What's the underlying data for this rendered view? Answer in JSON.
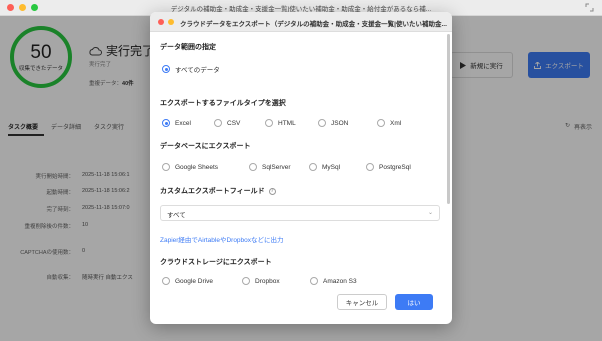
{
  "window": {
    "title": "デジタルの補助金・助成金・支援金一覧|使いたい補助金・助成金・給付金があるなら補..."
  },
  "summary": {
    "count": "50",
    "count_caption": "収集できたデータ",
    "status_title": "実行完了",
    "status_sub": "実行完了",
    "dedupe_label": "重複データ：",
    "dedupe_value": "40件"
  },
  "toolbar": {
    "run_label": "新規に実行",
    "export_label": "エクスポート"
  },
  "tabs": [
    {
      "label": "タスク概要"
    },
    {
      "label": "データ詳細"
    },
    {
      "label": "タスク実行"
    }
  ],
  "refresh_label": "再表示",
  "details": [
    {
      "label": "実行開始時間：",
      "value": "2025-11-18 15:06:1"
    },
    {
      "label": "起動時間：",
      "value": "2025-11-18 15:06:2"
    },
    {
      "label": "完了時刻：",
      "value": "2025-11-18 15:07:0"
    },
    {
      "label": "重複削除後の件数：",
      "value": "10"
    },
    {
      "label": "CAPTCHAの使用数：",
      "value": "0"
    },
    {
      "label": "自動収集：",
      "value": "随時実行 自動エクス"
    }
  ],
  "modal": {
    "title": "クラウドデータをエクスポート（デジタルの補助金・助成金・支援金一覧|使いたい補助金...",
    "range_title": "データ範囲の指定",
    "range_option": "すべてのデータ",
    "filetype_title": "エクスポートするファイルタイプを選択",
    "filetypes": [
      {
        "label": "Excel",
        "checked": true
      },
      {
        "label": "CSV",
        "checked": false
      },
      {
        "label": "HTML",
        "checked": false
      },
      {
        "label": "JSON",
        "checked": false
      },
      {
        "label": "Xml",
        "checked": false
      }
    ],
    "db_title": "データベースにエクスポート",
    "databases": [
      {
        "label": "Google Sheets"
      },
      {
        "label": "SqlServer"
      },
      {
        "label": "MySql"
      },
      {
        "label": "PostgreSql"
      }
    ],
    "fields_title": "カスタムエクスポートフィールド",
    "fields_value": "すべて",
    "zapier_link": "Zapier経由でAirtableやDropboxなどに出力",
    "cloud_title": "クラウドストレージにエクスポート",
    "cloud": [
      {
        "label": "Google Drive"
      },
      {
        "label": "Dropbox"
      },
      {
        "label": "Amazon S3"
      }
    ],
    "cancel_label": "キャンセル",
    "ok_label": "はい"
  }
}
